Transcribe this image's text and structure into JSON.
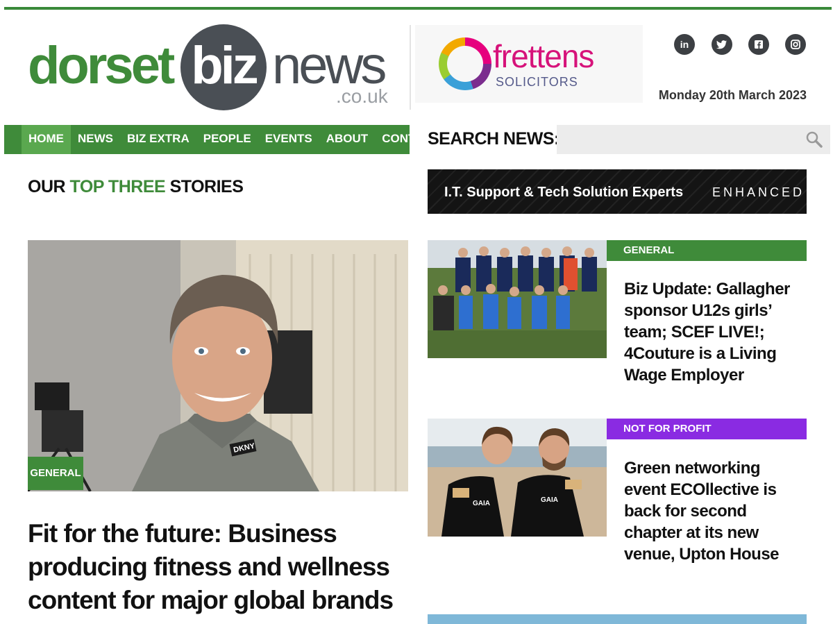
{
  "logo": {
    "part1": "dorset",
    "part2": "biz",
    "part3": "news",
    "suffix": ".co.uk"
  },
  "ad_top": {
    "brand": "frettens",
    "sub": "SOLICITORS"
  },
  "social": [
    {
      "icon": "linkedin-icon",
      "glyph": "in"
    },
    {
      "icon": "twitter-icon",
      "glyph": "t"
    },
    {
      "icon": "facebook-icon",
      "glyph": "f"
    },
    {
      "icon": "instagram-icon",
      "glyph": "◎"
    }
  ],
  "date": "Monday 20th March 2023",
  "nav": {
    "items": [
      "HOME",
      "NEWS",
      "BIZ EXTRA",
      "PEOPLE",
      "EVENTS",
      "ABOUT",
      "CONTACT"
    ],
    "active": "HOME"
  },
  "search": {
    "label": "SEARCH NEWS:",
    "value": "",
    "placeholder": ""
  },
  "section": {
    "pre": "OUR ",
    "highlight": "TOP THREE",
    "post": " STORIES"
  },
  "ad_it": {
    "text": "I.T. Support & Tech Solution Experts",
    "brand": "ENHANCED"
  },
  "main_story": {
    "category": "GENERAL",
    "headline": "Fit for the future: Business producing fitness and wellness content for major global brands",
    "shirt_logo": "DKNY"
  },
  "side_stories": [
    {
      "category": "GENERAL",
      "category_color": "#3f8b3a",
      "headline": "Biz Update: Gallagher sponsor U12s girls’ team; SCEF LIVE!; 4Couture is a Living Wage Employer"
    },
    {
      "category": "NOT FOR PROFIT",
      "category_color": "#8a2be2",
      "headline": "Green networking event ECOllective is back for second chapter at its new venue, Upton House",
      "shirt_logo": "GAIA"
    }
  ],
  "colors": {
    "brand_green": "#3f8b3a",
    "nav_active": "#5aa84f",
    "logo_grey": "#4a4f55",
    "nfp_purple": "#8a2be2"
  }
}
